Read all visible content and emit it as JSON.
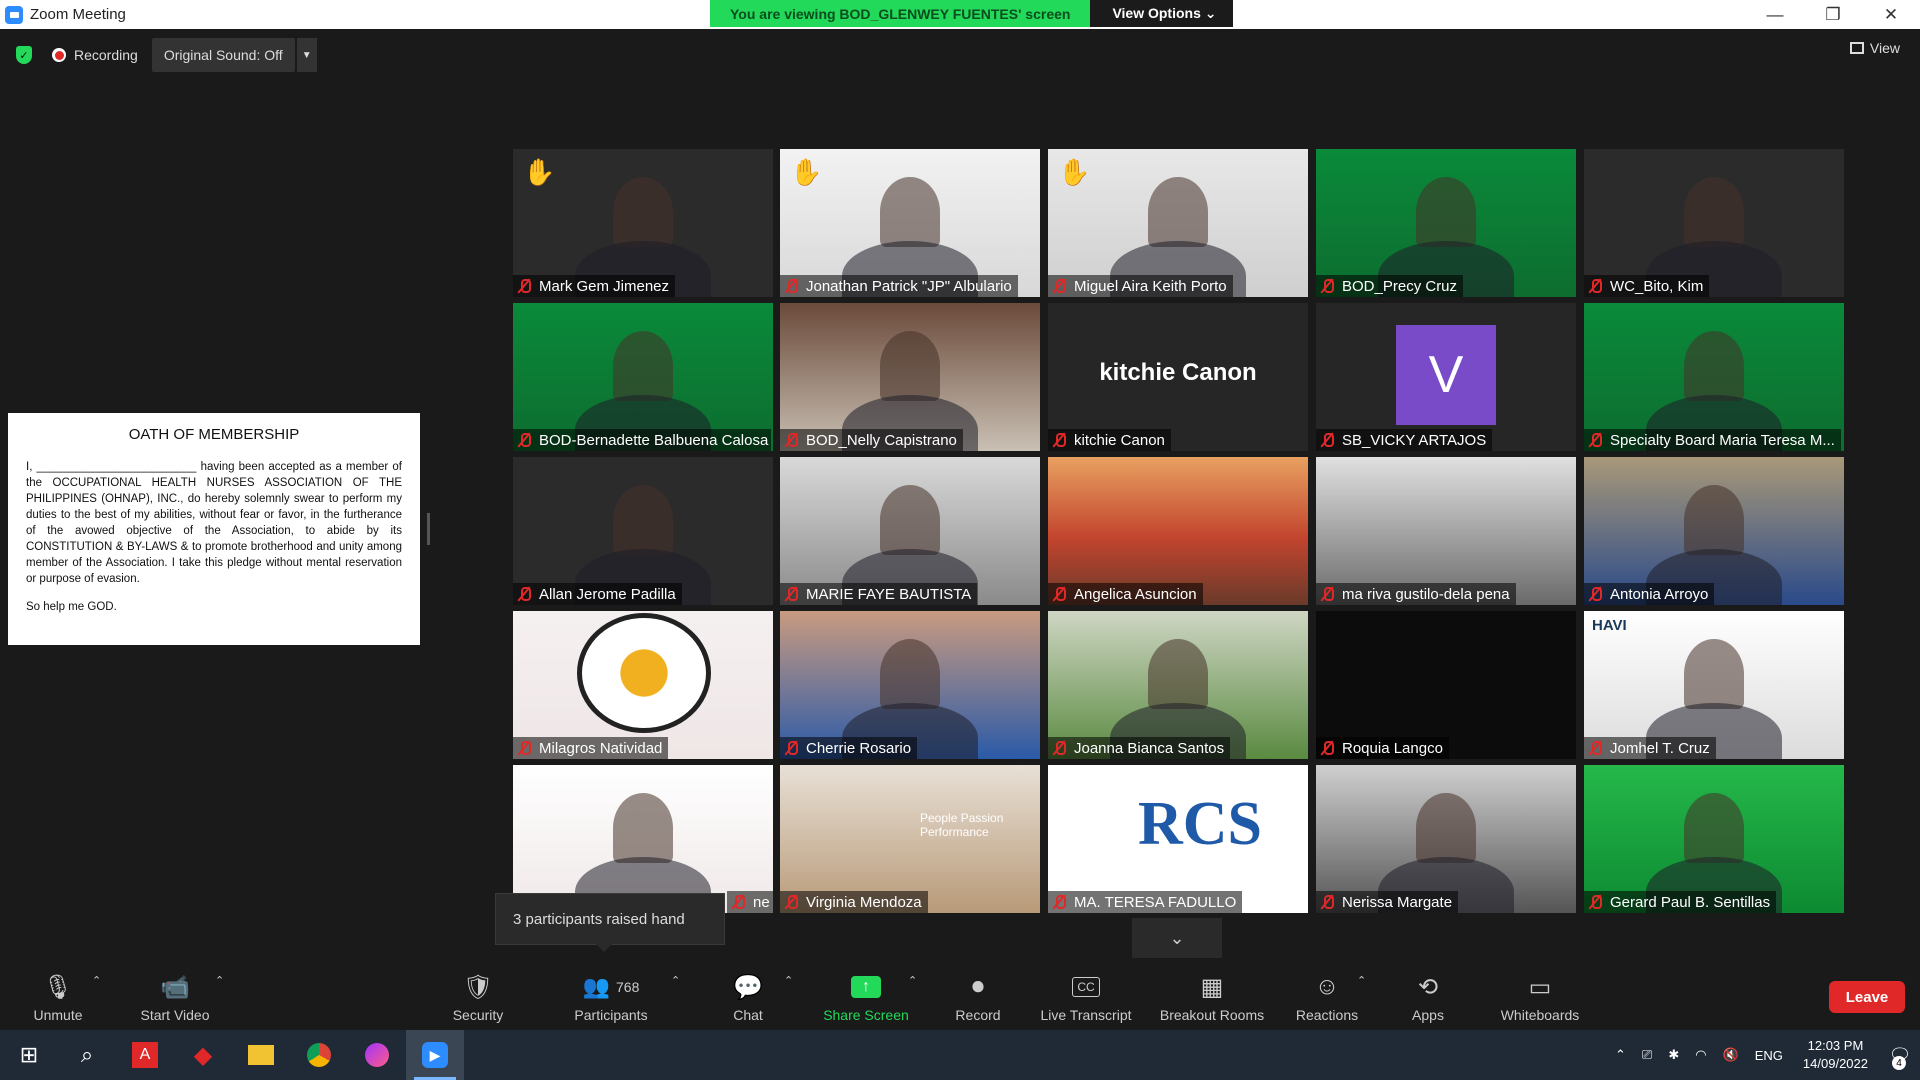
{
  "window": {
    "title": "Zoom Meeting",
    "minimize": "—",
    "restore": "❐",
    "close": "✕"
  },
  "banner": {
    "message": "You are viewing BOD_GLENWEY FUENTES' screen",
    "view_options": "View Options ⌄"
  },
  "topbar": {
    "recording_label": "Recording",
    "original_sound": "Original Sound: Off",
    "view_label": "View"
  },
  "oath": {
    "title": "OATH OF MEMBERSHIP",
    "body": "I, _________________________ having been accepted as a member of the OCCUPATIONAL HEALTH NURSES ASSOCIATION OF THE PHILIPPINES (OHNAP), INC., do hereby solemnly swear to perform my duties to the best of my abilities, without fear or favor, in the furtherance of the avowed objective of the Association, to abide by its CONSTITUTION & BY-LAWS &  to promote brotherhood and unity among member of the Association. I take this pledge without mental reservation or purpose of evasion.",
    "closing": "So help me GOD."
  },
  "participants": [
    {
      "name": "Mark Gem Jimenez",
      "hand": true
    },
    {
      "name": "Jonathan Patrick \"JP\" Albulario",
      "hand": true
    },
    {
      "name": "Miguel Aira Keith Porto",
      "hand": true
    },
    {
      "name": "BOD_Precy Cruz",
      "hand": false
    },
    {
      "name": "WC_Bito, Kim",
      "hand": false
    },
    {
      "name": "BOD-Bernadette Balbuena Calosa",
      "hand": false
    },
    {
      "name": "BOD_Nelly Capistrano",
      "hand": false
    },
    {
      "name": "kitchie Canon",
      "hand": false
    },
    {
      "name": "SB_VICKY ARTAJOS",
      "hand": false
    },
    {
      "name": "Specialty Board Maria Teresa M...",
      "hand": false
    },
    {
      "name": "Allan Jerome Padilla",
      "hand": false
    },
    {
      "name": "MARIE FAYE BAUTISTA",
      "hand": false
    },
    {
      "name": "Angelica Asuncion",
      "hand": false
    },
    {
      "name": "ma riva gustilo-dela pena",
      "hand": false
    },
    {
      "name": "Antonia Arroyo",
      "hand": false
    },
    {
      "name": "Milagros Natividad",
      "hand": false
    },
    {
      "name": "Cherrie Rosario",
      "hand": false
    },
    {
      "name": "Joanna Bianca Santos",
      "hand": false
    },
    {
      "name": "Roquia Langco",
      "hand": false
    },
    {
      "name": "Jomhel T. Cruz",
      "hand": false
    },
    {
      "name": "ne",
      "hand": false
    },
    {
      "name": "Virginia Mendoza",
      "hand": false
    },
    {
      "name": "MA. TERESA FADULLO",
      "hand": false
    },
    {
      "name": "Nerissa Margate",
      "hand": false
    },
    {
      "name": "Gerard Paul B. Sentillas",
      "hand": false
    }
  ],
  "tile_text": {
    "kitchie_big": "kitchie Canon",
    "vicky_initial": "V",
    "rcs_logo": "RCS",
    "havi_logo": "HAVI",
    "people_sign": "People Passion Performance"
  },
  "tooltip": {
    "text": "3 participants raised hand"
  },
  "toolbar": {
    "unmute": "Unmute",
    "start_video": "Start Video",
    "security": "Security",
    "participants": "Participants",
    "participant_count": "768",
    "chat": "Chat",
    "share_screen": "Share Screen",
    "record": "Record",
    "live_transcript": "Live Transcript",
    "breakout_rooms": "Breakout Rooms",
    "reactions": "Reactions",
    "apps": "Apps",
    "whiteboards": "Whiteboards",
    "leave": "Leave"
  },
  "taskbar": {
    "time": "12:03 PM",
    "date": "14/09/2022",
    "language": "ENG",
    "notification_count": "4"
  },
  "colors": {
    "accent_green": "#23d959",
    "leave_red": "#e02828",
    "zoom_blue": "#2d8cff",
    "active_speaker": "#e2e85a"
  }
}
